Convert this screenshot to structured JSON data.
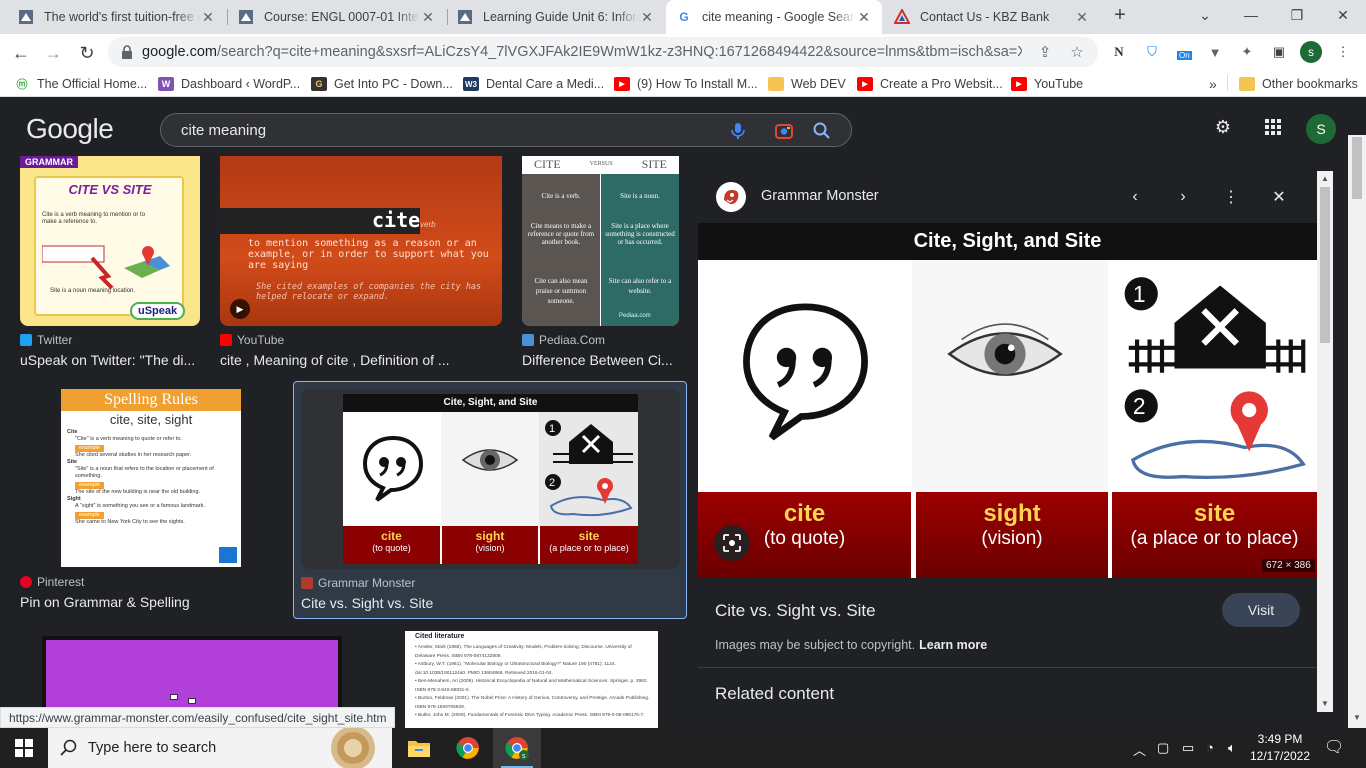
{
  "tabs": [
    {
      "title": "The world's first tuition-free o",
      "icon": "university-icon"
    },
    {
      "title": "Course: ENGL 0007-01 Interm",
      "icon": "university-icon"
    },
    {
      "title": "Learning Guide Unit 6: Inform",
      "icon": "university-icon"
    },
    {
      "title": "cite meaning - Google Search",
      "icon": "google-icon"
    },
    {
      "title": "Contact Us - KBZ Bank",
      "icon": "kbz-icon"
    }
  ],
  "address": {
    "domain": "google.com",
    "path": "/search?q=cite+meaning&sxsrf=ALiCzsY4_7lVGXJFAk2IE9WmW1kz-z3HNQ:1671268494422&source=lnms&tbm=isch&sa=X&ved..."
  },
  "profile_initial": "s",
  "extension_badge": "On",
  "bookmarks": [
    {
      "label": "The Official Home...",
      "icon": "mla-icon",
      "color": "#4caf50"
    },
    {
      "label": "Dashboard ‹ WordP...",
      "icon": "woo-icon",
      "color": "#7f54b3"
    },
    {
      "label": "Get Into PC - Down...",
      "icon": "getintopc-icon",
      "color": "#333333"
    },
    {
      "label": "Dental Care a Medi...",
      "icon": "w3-icon",
      "color": "#1e3a5f"
    },
    {
      "label": "(9) How To Install M...",
      "icon": "youtube-icon",
      "color": "#ff0000"
    },
    {
      "label": "Web DEV",
      "icon": "folder-icon",
      "color": "#f5c451"
    },
    {
      "label": "Create a Pro Websit...",
      "icon": "youtube-icon",
      "color": "#ff0000"
    },
    {
      "label": "YouTube",
      "icon": "youtube-icon",
      "color": "#ff0000"
    }
  ],
  "bookmarks_more": "»",
  "other_bookmarks": "Other bookmarks",
  "google": {
    "logo": "Google",
    "query": "cite meaning",
    "avatar": "S"
  },
  "results": [
    {
      "source": "Twitter",
      "caption": "uSpeak on Twitter: \"The di...",
      "source_color": "#1da1f2",
      "thumb": {
        "badge": "GRAMMAR",
        "title": "CITE VS SITE",
        "line1": "Cite is a verb meaning to mention or to make a reference to.",
        "line2": "Site is a noun meaning location.",
        "brand": "uSpeak"
      }
    },
    {
      "source": "YouTube",
      "caption": "cite , Meaning of cite , Definition of ...",
      "source_color": "#ff0000",
      "thumb": {
        "word": "cite",
        "pos": "verb",
        "def": "to mention something as a reason or an example, or in order to support what you are saying",
        "example": "She cited examples of companies the city has helped relocate or expand."
      }
    },
    {
      "source": "Pediaa.Com",
      "caption": "Difference Between Ci...",
      "source_color": "#4a90d9",
      "thumb": {
        "left": "CITE",
        "versus": "VERSUS",
        "right": "SITE",
        "l1": "Cite is a verb.",
        "r1": "Site is a noun.",
        "l2": "Cite means to make a reference or quote from another book.",
        "r2": "Site is a place where something is constructed or has occurred.",
        "l3": "Cite can also mean praise or summon someone.",
        "r3": "Site can also refer to a website.",
        "brand": "Pediaa.com"
      }
    },
    {
      "source": "Pinterest",
      "caption": "Pin on Grammar & Spelling",
      "source_color": "#e60023",
      "thumb": {
        "title": "Spelling Rules",
        "subtitle": "cite, site, sight"
      }
    },
    {
      "source": "Grammar Monster",
      "caption": "Cite vs. Sight vs. Site",
      "source_color": "#b03a2e",
      "thumb": {
        "title": "Cite, Sight, and Site"
      }
    },
    {
      "source": "",
      "caption": "",
      "thumb": {
        "title": "Cited literature"
      }
    }
  ],
  "labels": {
    "w1": "cite",
    "m1": "(to quote)",
    "w2": "sight",
    "m2": "(vision)",
    "w3": "site",
    "m3": "(a place or to place)"
  },
  "panel": {
    "site": "Grammar Monster",
    "image_title": "Cite, Sight, and Site",
    "dimensions": "672 × 386",
    "title": "Cite vs. Sight vs. Site",
    "visit": "Visit",
    "copyright": "Images may be subject to copyright.",
    "learn_more": "Learn more",
    "related": "Related content"
  },
  "status_url": "https://www.grammar-monster.com/easily_confused/cite_sight_site.htm",
  "taskbar": {
    "search_placeholder": "Type here to search",
    "time": "3:49 PM",
    "date": "12/17/2022"
  }
}
